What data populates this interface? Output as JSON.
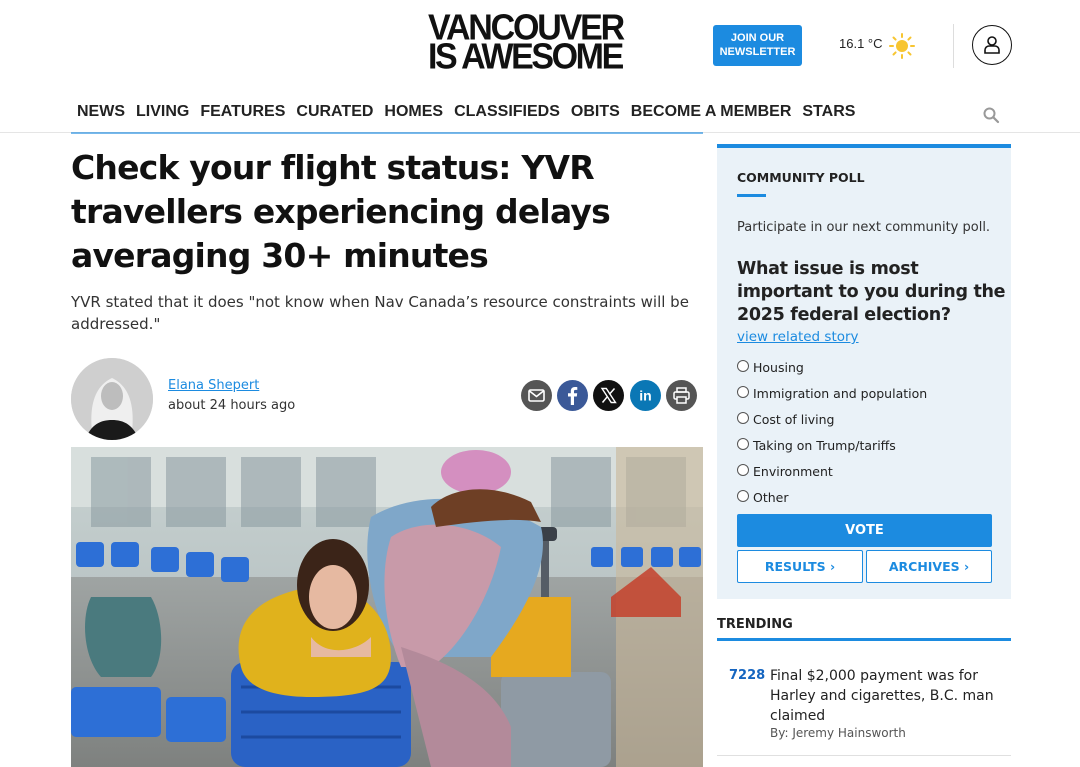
{
  "header": {
    "logo_line1": "VANCOUVER",
    "logo_line2": "IS AWESOME",
    "join_line1": "JOIN OUR",
    "join_line2": "NEWSLETTER",
    "temperature": "16.1 °C",
    "weather_icon": "sun-icon",
    "account_icon": "user-icon"
  },
  "nav": {
    "items": [
      "NEWS",
      "LIVING",
      "FEATURES",
      "CURATED",
      "HOMES",
      "CLASSIFIEDS",
      "OBITS",
      "BECOME A MEMBER",
      "STARS"
    ],
    "search_icon": "search-icon"
  },
  "article": {
    "headline": "Check your flight status: YVR travellers experiencing delays averaging 30+ minutes",
    "dek": "YVR stated that it does \"not know when Nav Canada’s resource constraints will be addressed.\"",
    "author": "Elana Shepert",
    "time": "about 24 hours ago",
    "share_icons": [
      "email-icon",
      "facebook-icon",
      "x-icon",
      "linkedin-icon",
      "print-icon"
    ]
  },
  "poll": {
    "title": "COMMUNITY POLL",
    "intro": "Participate in our next community poll.",
    "question": "What issue is most important to you during the 2025 federal election?",
    "link": "view related story",
    "options": [
      "Housing",
      "Immigration and population",
      "Cost of living",
      "Taking on Trump/tariffs",
      "Environment",
      "Other"
    ],
    "vote_label": "VOTE",
    "results_label": "RESULTS ›",
    "archives_label": "ARCHIVES ›"
  },
  "trending": {
    "title": "TRENDING",
    "items": [
      {
        "count": "7228",
        "headline": "Final $2,000 payment was for Harley and cigarettes, B.C. man claimed",
        "byline": "By: Jeremy Hainsworth"
      }
    ]
  },
  "colors": {
    "accent": "#1c8be0",
    "poll_bg": "#eaf2f8"
  }
}
